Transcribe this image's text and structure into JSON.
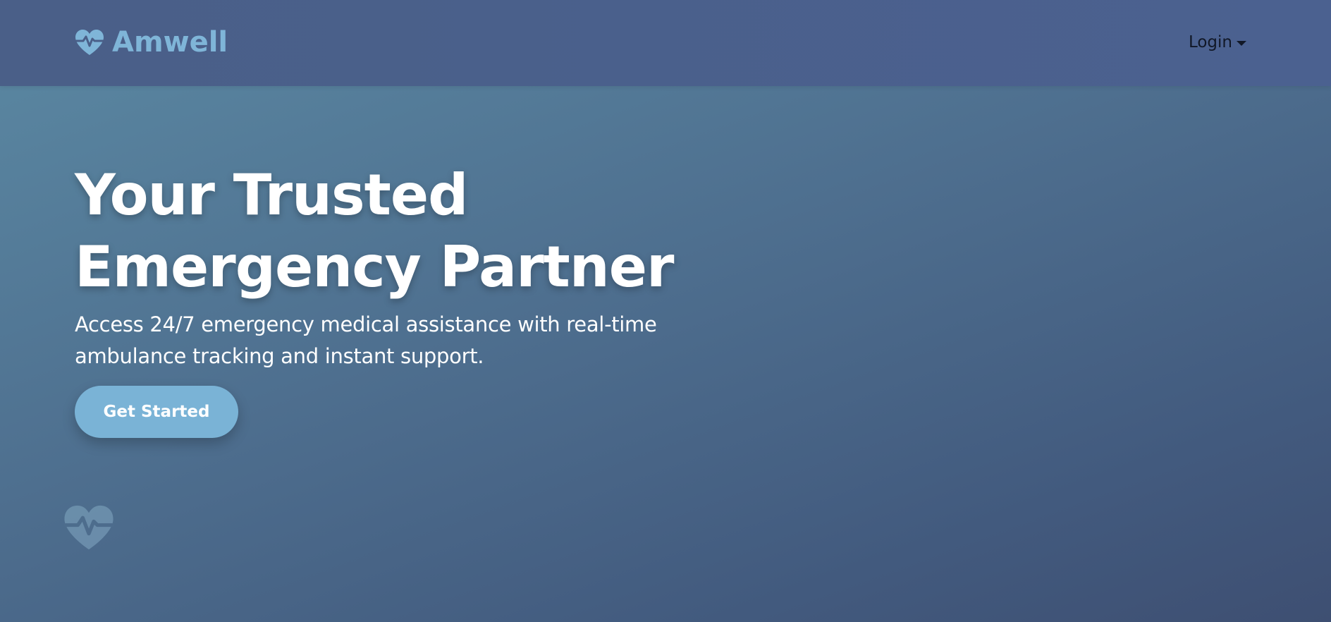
{
  "header": {
    "brand_name": "Amwell",
    "login_label": "Login"
  },
  "hero": {
    "title_line1": "Your Trusted",
    "title_line2": "Emergency Partner",
    "subtitle": "Access 24/7 emergency medical assistance with real-time ambulance tracking and instant support.",
    "cta_label": "Get Started"
  },
  "icons": {
    "brand": "heart-pulse-icon",
    "login_caret": "caret-down-icon",
    "decorative": "heart-pulse-icon"
  },
  "colors": {
    "brand_accent": "#7fb5d8",
    "button": "#7ab3d6",
    "navbar": "#4a5f88",
    "hero_text": "#ffffff"
  }
}
